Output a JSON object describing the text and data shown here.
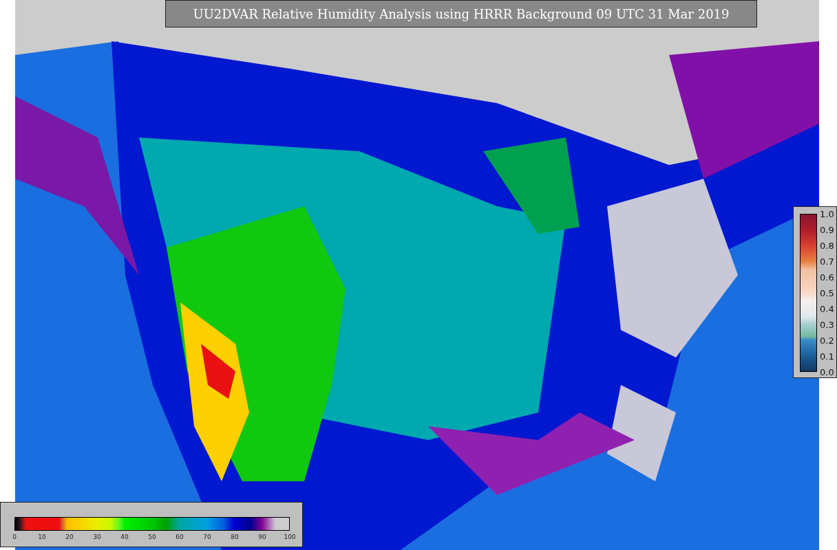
{
  "title": "UU2DVAR Relative Humidity Analysis using HRRR Background 09 UTC 31 Mar 2019",
  "humidity_colorbar": {
    "ticks": [
      "0",
      "10",
      "20",
      "30",
      "40",
      "50",
      "60",
      "70",
      "80",
      "90",
      "100"
    ]
  },
  "ratio_colorbar": {
    "ticks": [
      "1.0",
      "0.9",
      "0.8",
      "0.7",
      "0.6",
      "0.5",
      "0.4",
      "0.3",
      "0.2",
      "0.1",
      "0.0"
    ]
  }
}
